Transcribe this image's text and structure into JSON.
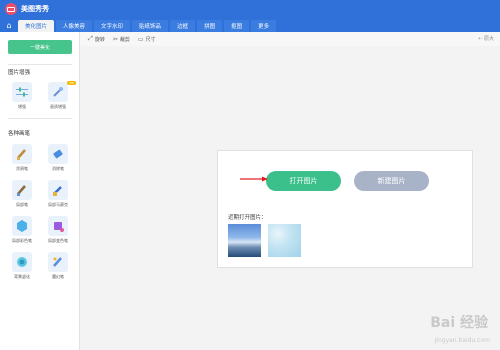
{
  "app": {
    "title": "美图秀秀"
  },
  "nav": {
    "tabs": [
      "美化图片",
      "人像美容",
      "文字水印",
      "贴纸饰品",
      "边框",
      "拼图",
      "抠图",
      "更多"
    ],
    "active_index": 0
  },
  "sidebar": {
    "one_key_label": "一键美化",
    "section1_label": "图片增强",
    "section1_tools": [
      {
        "label": "增强",
        "icon": "sliders-icon"
      },
      {
        "label": "画质增强",
        "icon": "sparkle-wand-icon",
        "badge": "VIP"
      }
    ],
    "section2_label": "各种画笔",
    "section2_tools": [
      {
        "label": "涂鸦笔",
        "icon": "paintbrush-icon"
      },
      {
        "label": "消除笔",
        "icon": "eraser-icon"
      },
      {
        "label": "局部笔",
        "icon": "brush-icon"
      },
      {
        "label": "局部马赛克",
        "icon": "mosaic-pen-icon"
      },
      {
        "label": "局部彩色笔",
        "icon": "color-pen-icon"
      },
      {
        "label": "局部变色笔",
        "icon": "recolor-pen-icon"
      },
      {
        "label": "背景虚化",
        "icon": "blur-icon"
      },
      {
        "label": "魔幻笔",
        "icon": "magic-pen-icon"
      }
    ]
  },
  "toolbar": {
    "rotate_label": "旋转",
    "crop_label": "裁剪",
    "size_label": "尺寸",
    "zoom_label": "原大"
  },
  "panel": {
    "open_label": "打开图片",
    "new_label": "新建图片",
    "recent_label": "近期打开图片："
  },
  "watermark": {
    "text": "Bai 经验",
    "sub": "jingyan.baidu.com"
  },
  "colors": {
    "brand_blue": "#2f71d9",
    "green": "#3bc08b",
    "gray_button": "#a9b3c8"
  }
}
